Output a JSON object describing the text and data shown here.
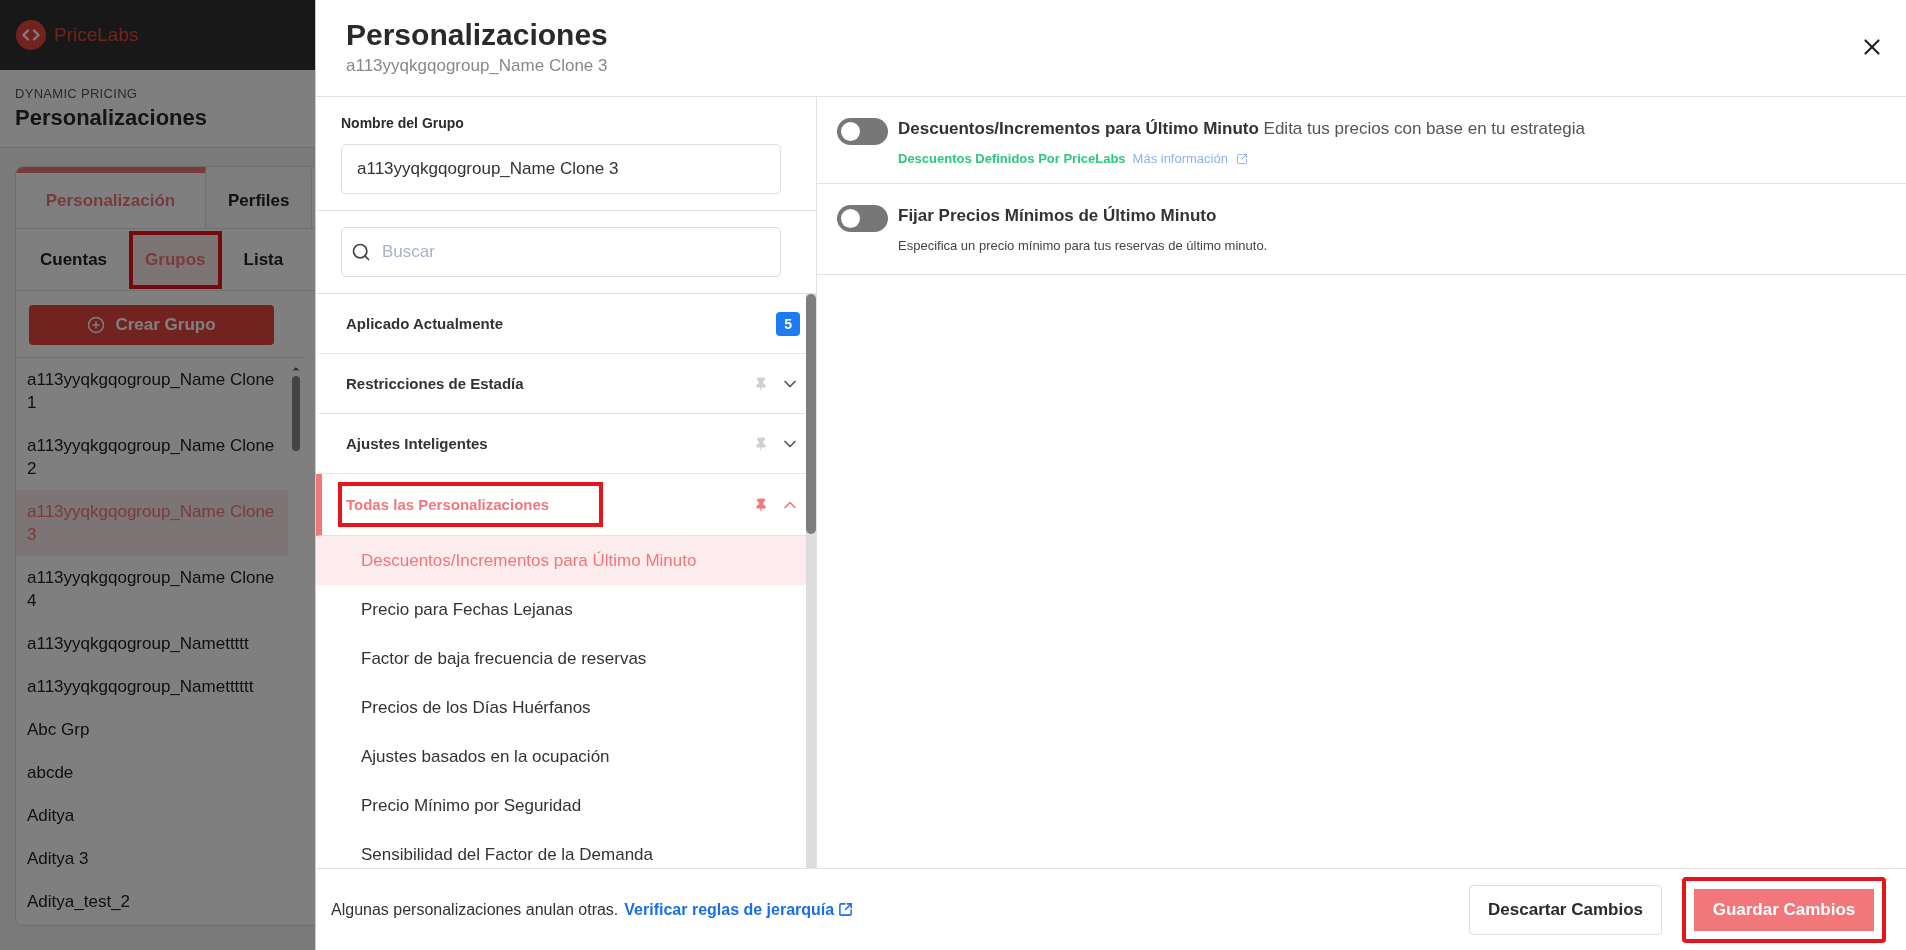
{
  "app": {
    "logo": "PriceLabs"
  },
  "page": {
    "eyebrow": "DYNAMIC PRICING",
    "title": "Personalizaciones"
  },
  "tabs": [
    {
      "label": "Personalización",
      "selected": true
    },
    {
      "label": "Perfiles",
      "selected": false
    }
  ],
  "subtabs": [
    {
      "label": "Cuentas",
      "selected": false,
      "annotated": false
    },
    {
      "label": "Grupos",
      "selected": true,
      "annotated": true
    },
    {
      "label": "Lista",
      "selected": false,
      "annotated": false
    }
  ],
  "create_button": "Crear Grupo",
  "groups": [
    {
      "name": "a113yyqkgqogroup_Name Clone 1",
      "selected": false
    },
    {
      "name": "a113yyqkgqogroup_Name Clone 2",
      "selected": false
    },
    {
      "name": "a113yyqkgqogroup_Name Clone 3",
      "selected": true
    },
    {
      "name": "a113yyqkgqogroup_Name Clone 4",
      "selected": false
    },
    {
      "name": "a113yyqkgqogroup_Namettttt",
      "selected": false
    },
    {
      "name": "a113yyqkgqogroup_Nametttttt",
      "selected": false
    },
    {
      "name": "Abc Grp",
      "selected": false
    },
    {
      "name": "abcde",
      "selected": false
    },
    {
      "name": "Aditya",
      "selected": false
    },
    {
      "name": "Aditya 3",
      "selected": false
    },
    {
      "name": "Aditya_test_2",
      "selected": false
    }
  ],
  "modal": {
    "title": "Personalizaciones",
    "subtitle": "a113yyqkgqogroup_Name Clone 3",
    "name_field": {
      "label": "Nombre del Grupo",
      "value": "a113yyqkgqogroup_Name Clone 3"
    },
    "search": {
      "placeholder": "Buscar"
    },
    "sections": [
      {
        "kind": "count",
        "label": "Aplicado Actualmente",
        "count": "5",
        "selected": false
      },
      {
        "kind": "collapsible",
        "label": "Restricciones de Estadía",
        "selected": false,
        "expanded": false,
        "pinned": false,
        "annotated": false
      },
      {
        "kind": "collapsible",
        "label": "Ajustes Inteligentes",
        "selected": false,
        "expanded": false,
        "pinned": false,
        "annotated": false
      },
      {
        "kind": "collapsible",
        "label": "Todas las Personalizaciones",
        "selected": true,
        "expanded": true,
        "pinned": true,
        "annotated": true,
        "items": [
          {
            "label": "Descuentos/Incrementos para Último Minuto",
            "selected": true
          },
          {
            "label": "Precio para Fechas Lejanas",
            "selected": false
          },
          {
            "label": "Factor de baja frecuencia de reservas",
            "selected": false
          },
          {
            "label": "Precios de los Días Huérfanos",
            "selected": false
          },
          {
            "label": "Ajustes basados en la ocupación",
            "selected": false
          },
          {
            "label": "Precio Mínimo por Seguridad",
            "selected": false
          },
          {
            "label": "Sensibilidad del Factor de la Demanda",
            "selected": false
          }
        ]
      }
    ],
    "settings": [
      {
        "title": "Descuentos/Incrementos para Último Minuto",
        "description": "Edita tus precios con base en tu estrategia",
        "on": false,
        "tag": "Descuentos Definidos Por PriceLabs",
        "link": "Más información"
      },
      {
        "title": "Fijar Precios Mínimos de Último Minuto",
        "note": "Especifica un precio mínimo para tus reservas de último minuto.",
        "on": false
      }
    ],
    "footer": {
      "note": "Algunas personalizaciones anulan otras.",
      "link": "Verificar reglas de jerarquía",
      "buttons": [
        {
          "kind": "secondary",
          "label": "Descartar Cambios",
          "annotated": false
        },
        {
          "kind": "primary",
          "label": "Guardar Cambios",
          "annotated": true
        }
      ]
    }
  }
}
